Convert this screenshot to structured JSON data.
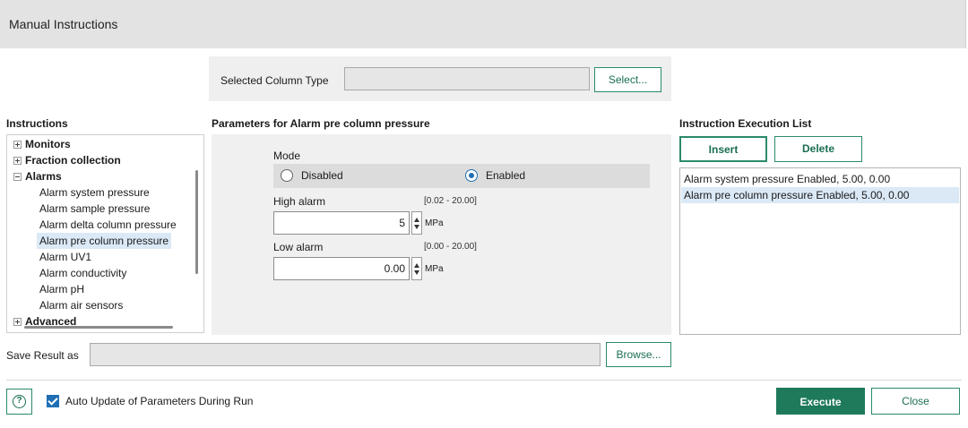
{
  "window": {
    "title": "Manual Instructions"
  },
  "column_type": {
    "label": "Selected Column Type",
    "value": "",
    "select_button": "Select..."
  },
  "instructions": {
    "heading": "Instructions",
    "groups": [
      {
        "label": "Monitors",
        "expander": "+"
      },
      {
        "label": "Fraction collection",
        "expander": "+"
      },
      {
        "label": "Alarms",
        "expander": "-"
      }
    ],
    "alarm_items": [
      "Alarm system pressure",
      "Alarm sample pressure",
      "Alarm delta column pressure",
      "Alarm pre column pressure",
      "Alarm UV1",
      "Alarm conductivity",
      "Alarm pH",
      "Alarm air sensors"
    ],
    "partial_group": "Advanced",
    "selected_item": "Alarm pre column pressure"
  },
  "parameters": {
    "heading": "Parameters for Alarm pre column pressure",
    "mode_label": "Mode",
    "mode_options": [
      "Disabled",
      "Enabled"
    ],
    "mode_selected": "Enabled",
    "high_alarm": {
      "label": "High alarm",
      "range": "[0.02 - 20.00]",
      "value": "5",
      "unit": "MPa"
    },
    "low_alarm": {
      "label": "Low alarm",
      "range": "[0.00 - 20.00]",
      "value": "0.00",
      "unit": "MPa"
    }
  },
  "execution_list": {
    "heading": "Instruction Execution List",
    "insert_label": "Insert",
    "delete_label": "Delete",
    "items": [
      "Alarm system pressure Enabled, 5.00, 0.00",
      "Alarm pre column pressure Enabled, 5.00, 0.00"
    ],
    "selected_index": 1
  },
  "save_result": {
    "label": "Save Result as",
    "value": "",
    "browse_label": "Browse..."
  },
  "footer": {
    "help_glyph": "?",
    "auto_update_label": "Auto Update of Parameters During Run",
    "auto_update_checked": true,
    "execute_label": "Execute",
    "close_label": "Close"
  },
  "colors": {
    "accent": "#1f7a5c",
    "selection": "#dbe9f7",
    "check": "#1f6fb5"
  }
}
